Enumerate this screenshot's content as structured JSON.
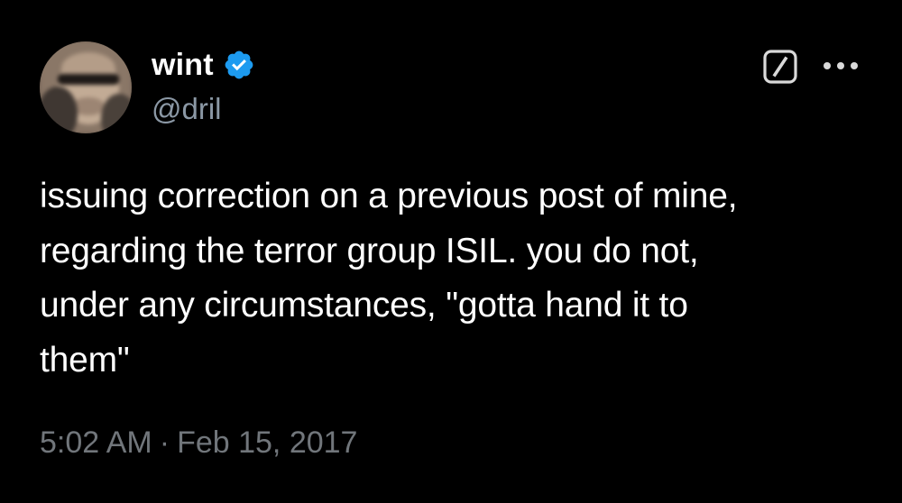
{
  "user": {
    "display_name": "wint",
    "handle": "@dril",
    "verified": true,
    "verified_color": "#1d9bf0"
  },
  "icons": {
    "grok": "grok-icon",
    "more": "more-dots-icon",
    "verified": "verified-badge-icon"
  },
  "post": {
    "text": "issuing correction on a previous post of mine,\nregarding the terror group ISIL. you do not,\nunder any circumstances, \"gotta hand it to\nthem\"",
    "time": "5:02 AM",
    "separator": "·",
    "date": "Feb 15, 2017"
  },
  "colors": {
    "background": "#000000",
    "text": "#ffffff",
    "secondary_text": "#71767b",
    "handle_text": "#8b98a5"
  }
}
